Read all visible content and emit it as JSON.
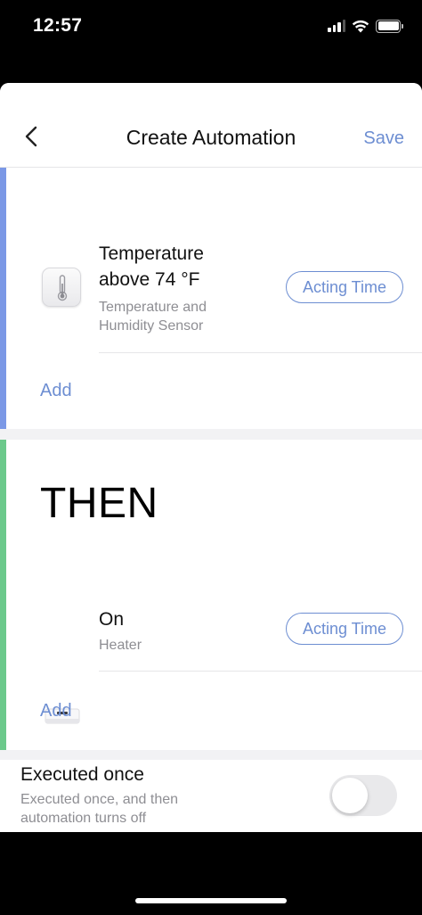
{
  "status_bar": {
    "time": "12:57",
    "icons": [
      "cellular-signal-icon",
      "wifi-icon",
      "battery-icon"
    ]
  },
  "nav": {
    "title": "Create Automation",
    "save_label": "Save",
    "back_icon": "chevron-left-icon"
  },
  "if_section": {
    "condition": {
      "title_line1": "Temperature",
      "title_line2": "above 74 °F",
      "device_line1": "Temperature and",
      "device_line2": "Humidity Sensor",
      "icon": "thermometer-icon",
      "acting_time_label": "Acting Time"
    },
    "add_label": "Add"
  },
  "then_section": {
    "heading": "THEN",
    "action": {
      "title": "On",
      "device": "Heater",
      "icon": "heater-icon",
      "acting_time_label": "Acting Time"
    },
    "add_label": "Add"
  },
  "executed_once": {
    "title": "Executed once",
    "description_line1": "Executed once, and then",
    "description_line2": "automation turns off",
    "toggle_on": false
  },
  "colors": {
    "accent": "#6d8ed2",
    "if_bar": "#7b98e6",
    "then_bar": "#6cc98b",
    "secondary_text": "#8e8e93"
  }
}
